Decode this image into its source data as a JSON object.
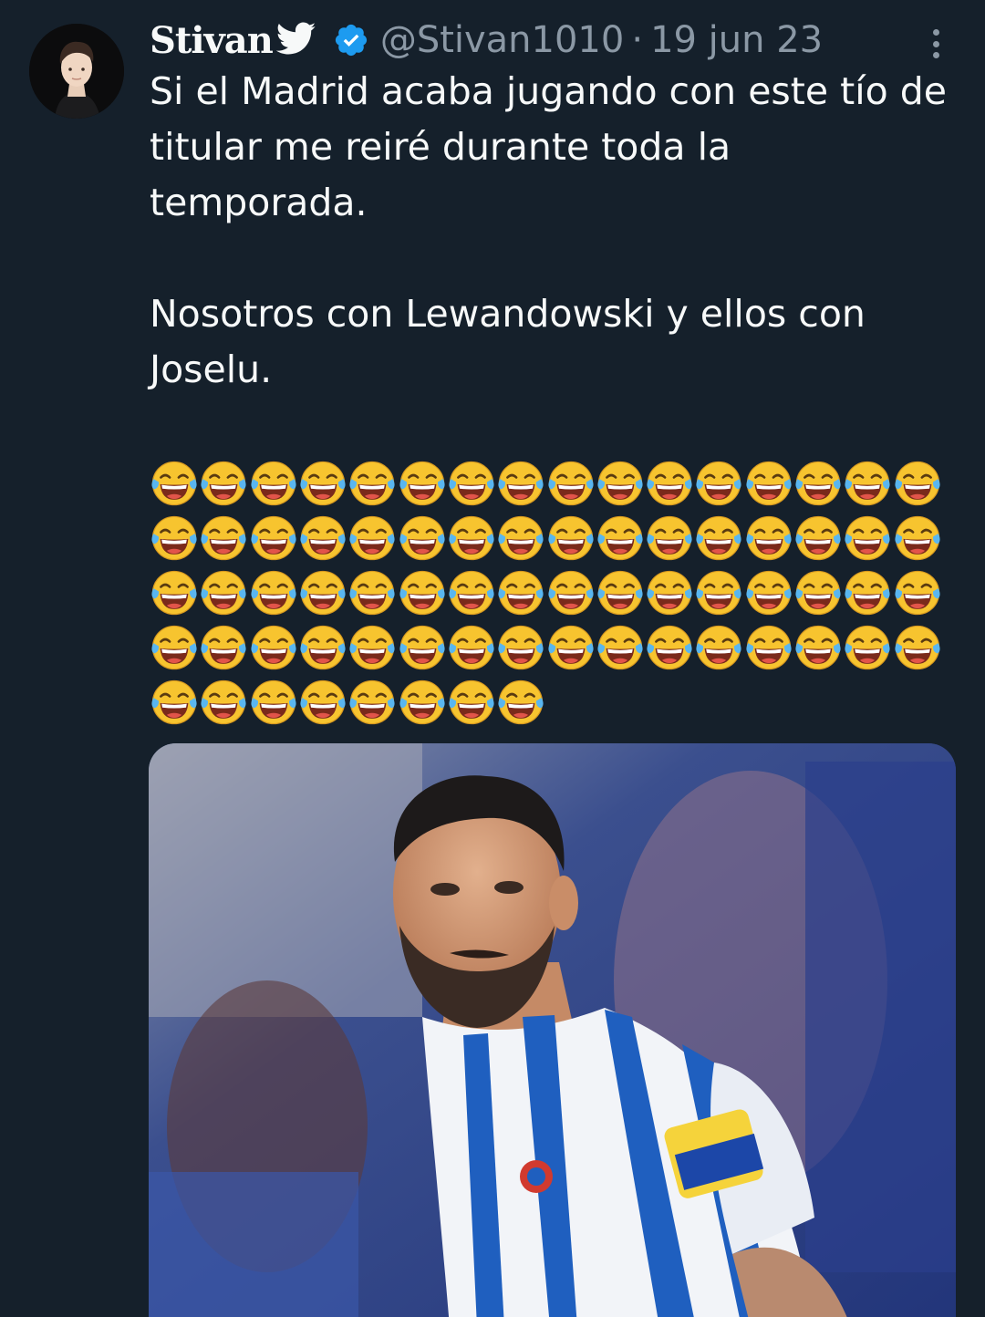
{
  "tweet": {
    "author": {
      "display_name": "Stivan",
      "handle": "@Stivan1010",
      "verified": true
    },
    "separator": "·",
    "date": "19 jun 23",
    "text": {
      "paragraph1": "Si el Madrid acaba jugando con este tío de titular me reiré durante toda la temporada.",
      "paragraph2": "Nosotros con Lewandowski y ellos con Joselu."
    },
    "emoji": {
      "name": "face-with-tears-of-joy",
      "count": 72
    },
    "media": {
      "kind": "photo"
    }
  },
  "colors": {
    "background": "#15202b",
    "text_primary": "#f7f9f9",
    "text_secondary": "#8b98a5",
    "verified_blue": "#1d9bf0"
  },
  "icons": [
    "avatar",
    "bird-icon",
    "verified-badge-icon",
    "more-options-icon",
    "face-with-tears-of-joy-emoji"
  ]
}
